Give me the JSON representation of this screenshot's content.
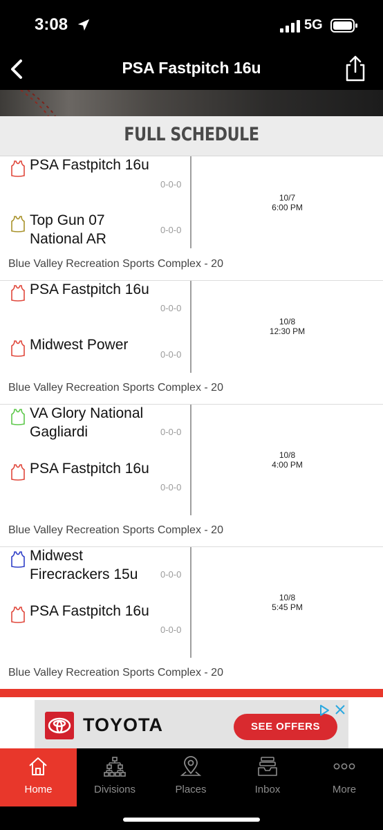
{
  "status_bar": {
    "time": "3:08",
    "network": "5G",
    "icons": [
      "location-arrow-icon",
      "signal-icon",
      "battery-icon"
    ]
  },
  "nav": {
    "title": "PSA Fastpitch 16u",
    "back_icon": "chevron-left-icon",
    "share_icon": "share-icon"
  },
  "section": {
    "title": "FULL SCHEDULE"
  },
  "games": [
    {
      "home": {
        "name": "PSA Fastpitch 16u",
        "record": "0-0-0",
        "jersey_color": "#e0473b"
      },
      "away": {
        "name": "Top Gun 07 National AR",
        "record": "0-0-0",
        "jersey_color": "#a8922a"
      },
      "date": "10/7",
      "time": "6:00 PM",
      "venue": "Blue Valley Recreation Sports Complex - 20"
    },
    {
      "home": {
        "name": "PSA Fastpitch 16u",
        "record": "0-0-0",
        "jersey_color": "#e0473b"
      },
      "away": {
        "name": "Midwest Power",
        "record": "0-0-0",
        "jersey_color": "#e0473b"
      },
      "date": "10/8",
      "time": "12:30 PM",
      "venue": "Blue Valley Recreation Sports Complex - 20"
    },
    {
      "home": {
        "name": "VA Glory National Gagliardi",
        "record": "0-0-0",
        "jersey_color": "#5dc84b"
      },
      "away": {
        "name": "PSA Fastpitch 16u",
        "record": "0-0-0",
        "jersey_color": "#e0473b"
      },
      "date": "10/8",
      "time": "4:00 PM",
      "venue": "Blue Valley Recreation Sports Complex - 20"
    },
    {
      "home": {
        "name": "Midwest Firecrackers 15u",
        "record": "0-0-0",
        "jersey_color": "#2f3fc8"
      },
      "away": {
        "name": "PSA Fastpitch 16u",
        "record": "0-0-0",
        "jersey_color": "#e0473b"
      },
      "date": "10/8",
      "time": "5:45 PM",
      "venue": "Blue Valley Recreation Sports Complex - 20"
    }
  ],
  "ad": {
    "brand": "TOYOTA",
    "cta": "SEE OFFERS",
    "brand_color": "#d2212d"
  },
  "tabs": [
    {
      "label": "Home",
      "icon": "house-icon"
    },
    {
      "label": "Divisions",
      "icon": "bracket-icon"
    },
    {
      "label": "Places",
      "icon": "map-pin-icon"
    },
    {
      "label": "Inbox",
      "icon": "inbox-tray-icon"
    },
    {
      "label": "More",
      "icon": "more-dots-icon"
    }
  ],
  "colors": {
    "accent": "#e8372b",
    "bar": "#000000"
  }
}
